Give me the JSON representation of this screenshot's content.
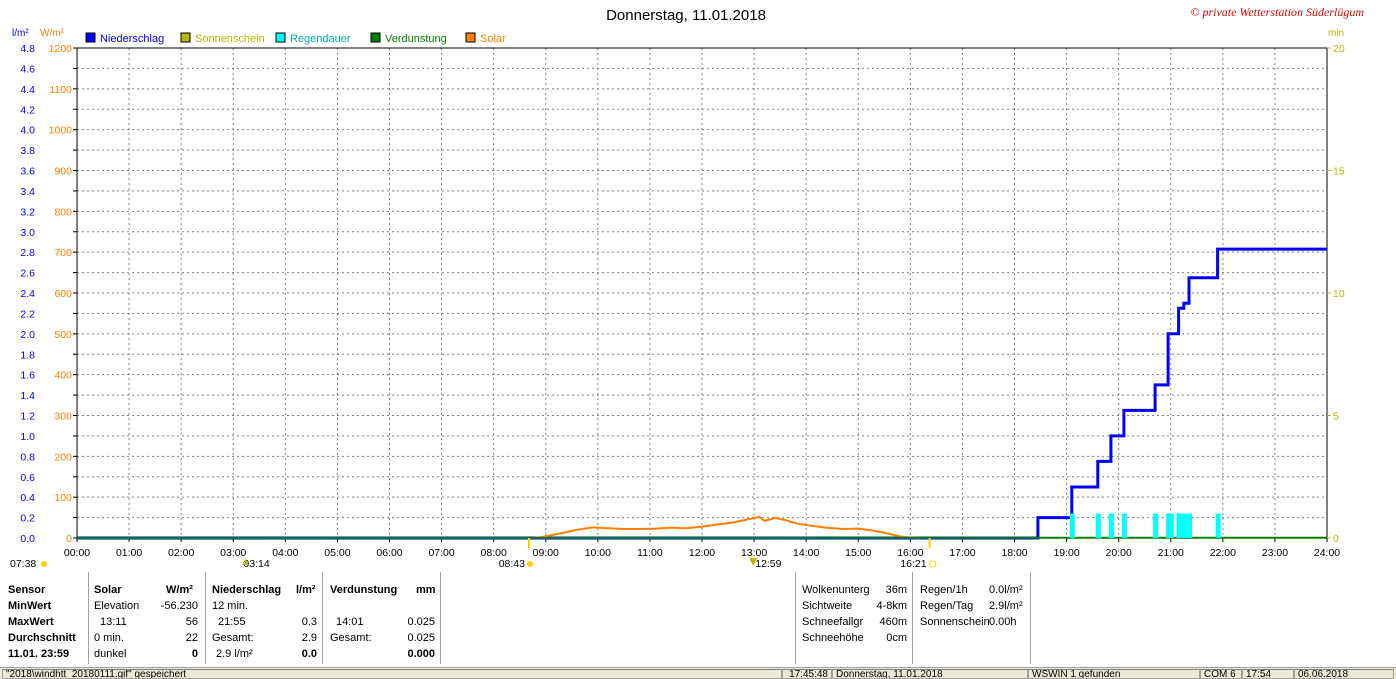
{
  "title": "Donnerstag, 11.01.2018",
  "copyright": "© private Wetterstation Süderlügum",
  "units": {
    "left1": "l/m²",
    "left2": "W/m²",
    "right": "min"
  },
  "legend": [
    {
      "label": "Niederschlag",
      "color": "#0000ff",
      "text_color": "#0000ff"
    },
    {
      "label": "Sonnenschein",
      "color": "#b8b800",
      "text_color": "#b8b800"
    },
    {
      "label": "Regendauer",
      "color": "#00ffff",
      "text_color": "#00b0b0"
    },
    {
      "label": "Verdunstung",
      "color": "#008000",
      "text_color": "#008000"
    },
    {
      "label": "Solar",
      "color": "#ff8000",
      "text_color": "#ff8000"
    }
  ],
  "markers": {
    "left_bottom": "07:38",
    "moon_up": "03:14",
    "sunrise": "08:43",
    "noon": "12:59",
    "sunset": "16:21"
  },
  "chart_data": {
    "type": "line",
    "x_unit": "time of day (hours)",
    "xlim": [
      0,
      24
    ],
    "x_tick_labels": [
      "00:00",
      "01:00",
      "02:00",
      "03:00",
      "04:00",
      "05:00",
      "06:00",
      "07:00",
      "08:00",
      "09:00",
      "10:00",
      "11:00",
      "12:00",
      "13:00",
      "14:00",
      "15:00",
      "16:00",
      "17:00",
      "18:00",
      "19:00",
      "20:00",
      "21:00",
      "22:00",
      "23:00",
      "24:00"
    ],
    "axes": {
      "precip": {
        "unit": "l/m²",
        "ylim": [
          0,
          4.8
        ],
        "ticks": [
          "0.0",
          "0.2",
          "0.4",
          "0.6",
          "0.8",
          "1.0",
          "1.2",
          "1.4",
          "1.6",
          "1.8",
          "2.0",
          "2.2",
          "2.4",
          "2.6",
          "2.8",
          "3.0",
          "3.2",
          "3.4",
          "3.6",
          "3.8",
          "4.0",
          "4.2",
          "4.4",
          "4.6",
          "4.8"
        ]
      },
      "solar": {
        "unit": "W/m²",
        "ylim": [
          0,
          1200
        ],
        "ticks": [
          "0",
          "100",
          "200",
          "300",
          "400",
          "500",
          "600",
          "700",
          "800",
          "900",
          "1000",
          "1100",
          "1200"
        ]
      },
      "minutes": {
        "unit": "min",
        "ylim": [
          0,
          20
        ],
        "ticks": [
          "0",
          "5",
          "10",
          "15",
          "20"
        ]
      }
    },
    "grid": true,
    "series": [
      {
        "name": "Niederschlag",
        "axis": "precip",
        "step": true,
        "points": [
          [
            0,
            0
          ],
          [
            18.45,
            0
          ],
          [
            18.45,
            0.2
          ],
          [
            19.1,
            0.2
          ],
          [
            19.1,
            0.5
          ],
          [
            19.6,
            0.5
          ],
          [
            19.6,
            0.75
          ],
          [
            19.85,
            0.75
          ],
          [
            19.85,
            1.0
          ],
          [
            20.1,
            1.0
          ],
          [
            20.1,
            1.25
          ],
          [
            20.7,
            1.25
          ],
          [
            20.7,
            1.5
          ],
          [
            20.95,
            1.5
          ],
          [
            20.95,
            2.0
          ],
          [
            21.15,
            2.0
          ],
          [
            21.15,
            2.25
          ],
          [
            21.25,
            2.25
          ],
          [
            21.25,
            2.3
          ],
          [
            21.35,
            2.3
          ],
          [
            21.35,
            2.55
          ],
          [
            21.9,
            2.55
          ],
          [
            21.9,
            2.83
          ],
          [
            24,
            2.83
          ]
        ]
      },
      {
        "name": "Solar",
        "axis": "solar",
        "points": [
          [
            8.8,
            0
          ],
          [
            9.0,
            4
          ],
          [
            9.3,
            12
          ],
          [
            9.6,
            20
          ],
          [
            9.9,
            26
          ],
          [
            10.2,
            24
          ],
          [
            10.5,
            22
          ],
          [
            10.8,
            22
          ],
          [
            11.1,
            23
          ],
          [
            11.4,
            25
          ],
          [
            11.7,
            24
          ],
          [
            12.0,
            28
          ],
          [
            12.3,
            33
          ],
          [
            12.6,
            38
          ],
          [
            12.9,
            46
          ],
          [
            13.1,
            52
          ],
          [
            13.2,
            42
          ],
          [
            13.4,
            49
          ],
          [
            13.6,
            44
          ],
          [
            13.8,
            36
          ],
          [
            14.1,
            30
          ],
          [
            14.4,
            25
          ],
          [
            14.7,
            22
          ],
          [
            15.0,
            23
          ],
          [
            15.3,
            18
          ],
          [
            15.6,
            10
          ],
          [
            15.8,
            4
          ],
          [
            16.0,
            1
          ],
          [
            16.2,
            0
          ]
        ]
      },
      {
        "name": "Verdunstung",
        "axis": "precip",
        "points": [
          [
            0,
            0
          ],
          [
            24,
            0.003
          ]
        ]
      },
      {
        "name": "Regendauer",
        "axis": "minutes",
        "type": "bar",
        "bars": [
          [
            19.1,
            1
          ],
          [
            19.6,
            1
          ],
          [
            19.85,
            1
          ],
          [
            20.1,
            1
          ],
          [
            20.7,
            1
          ],
          [
            20.95,
            1
          ],
          [
            21.0,
            1
          ],
          [
            21.15,
            1
          ],
          [
            21.25,
            1
          ],
          [
            21.35,
            1
          ],
          [
            21.9,
            1
          ]
        ]
      }
    ]
  },
  "summary": {
    "col_sensor": {
      "header": "Sensor",
      "rows": [
        "MinWert",
        "MaxWert",
        "Durchschnitt",
        "11.01. 23:59"
      ]
    },
    "col_solar": {
      "header": "Solar",
      "unit": "W/m²",
      "rows": [
        [
          "Elevation",
          "-56.230"
        ],
        [
          "13:11",
          "56"
        ],
        [
          "0 min.",
          "22"
        ],
        [
          "dunkel",
          "0"
        ]
      ]
    },
    "col_precip": {
      "header": "Niederschlag",
      "unit": "l/m²",
      "rows": [
        [
          "12 min.",
          ""
        ],
        [
          "21:55",
          "0.3"
        ],
        [
          "Gesamt:",
          "2.9"
        ],
        [
          "2.9 l/m²",
          "0.0"
        ]
      ]
    },
    "col_evap": {
      "header": "Verdunstung",
      "unit": "mm",
      "rows": [
        [
          "",
          ""
        ],
        [
          "14:01",
          "0.025"
        ],
        [
          "Gesamt:",
          "0.025"
        ],
        [
          "",
          "0.000"
        ]
      ]
    },
    "weather": [
      [
        "Wolkenunterg",
        "36m"
      ],
      [
        "Sichtweite",
        "4-8km"
      ],
      [
        "Schneefallgr",
        "460m"
      ],
      [
        "Schneehöhe",
        "0cm"
      ]
    ],
    "rain": [
      [
        "Regen/1h",
        "0.0l/m²"
      ],
      [
        "Regen/Tag",
        "2.9l/m²"
      ],
      [
        "Sonnenschein",
        "0.00h"
      ]
    ]
  },
  "statusbar": {
    "file": "\"2018\\windhtt_20180111.gif\" gespeichert",
    "time": "17:45:48",
    "date": "Donnerstag, 11.01.2018",
    "device": "WSWIN 1 gefunden",
    "port": "COM 6",
    "clock": "17:54",
    "today": "06.06.2018"
  }
}
